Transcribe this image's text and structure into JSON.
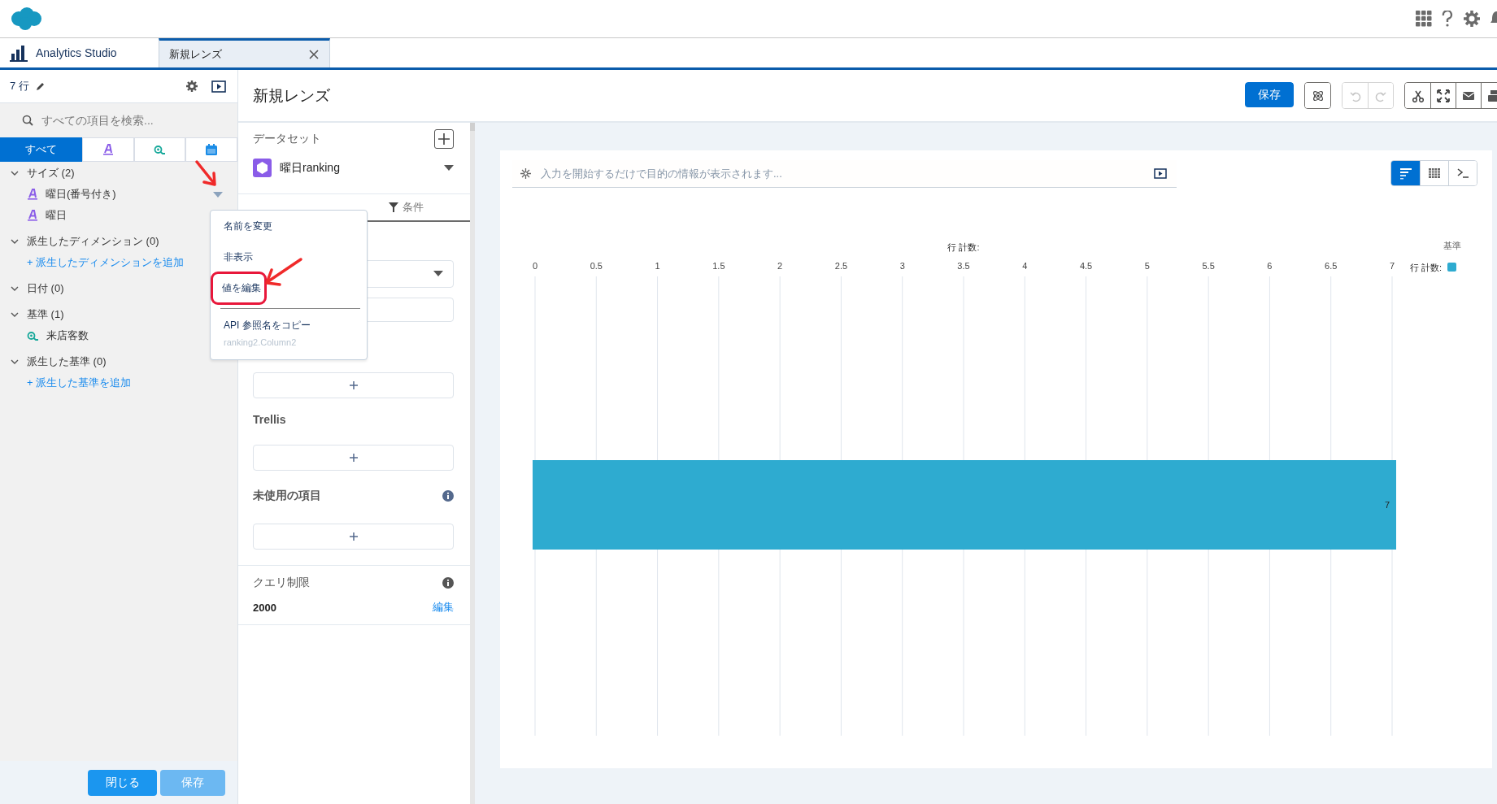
{
  "tabs": [
    {
      "kind": "home",
      "label": "Analytics Studio",
      "selected": false,
      "closable": false
    },
    {
      "kind": "document",
      "label": "新規レンズ",
      "selected": true,
      "closable": true
    }
  ],
  "left_panel": {
    "row_count": "7 行",
    "search": {
      "placeholder": "すべての項目を検索..."
    },
    "filter_tabs": [
      {
        "kind": "all",
        "label": "すべて",
        "selected": true
      },
      {
        "kind": "dimension",
        "selected": false
      },
      {
        "kind": "measure",
        "selected": false
      },
      {
        "kind": "date",
        "selected": false
      }
    ],
    "tree": [
      {
        "kind": "group",
        "label": "サイズ (2)",
        "expanded": true,
        "children": [
          {
            "kind": "dimension",
            "label": "曜日(番号付き)",
            "menu_open": true
          },
          {
            "kind": "dimension",
            "label": "曜日"
          }
        ]
      },
      {
        "kind": "group",
        "label": "派生したディメンション (0)",
        "expanded": true,
        "children": [
          {
            "kind": "add",
            "label": "+ 派生したディメンションを追加"
          }
        ]
      },
      {
        "kind": "group",
        "label": "日付 (0)",
        "expanded": true
      },
      {
        "kind": "group",
        "label": "基準 (1)",
        "expanded": true,
        "children": [
          {
            "kind": "measure",
            "label": "来店客数"
          }
        ]
      },
      {
        "kind": "group",
        "label": "派生した基準 (0)",
        "expanded": true,
        "children": [
          {
            "kind": "add",
            "label": "+ 派生した基準を追加"
          }
        ]
      }
    ],
    "buttons": [
      {
        "label": "閉じる",
        "disabled": false
      },
      {
        "label": "保存",
        "disabled": true
      }
    ]
  },
  "context_menu": {
    "items": [
      {
        "kind": "item",
        "label": "名前を変更",
        "highlighted": false
      },
      {
        "kind": "item",
        "label": "非表示",
        "highlighted": false
      },
      {
        "kind": "item",
        "label": "値を編集",
        "highlighted": true
      },
      {
        "kind": "divider"
      },
      {
        "kind": "copy",
        "label": "API 参照名をコピー",
        "detail": "ranking2.Column2"
      }
    ]
  },
  "annotations": [
    {
      "kind": "arrow"
    },
    {
      "kind": "arrow"
    }
  ],
  "lens": {
    "title": "新規レンズ",
    "toolbar": [
      {
        "kind": "save",
        "label": "保存",
        "disabled": false
      },
      {
        "kind": "explore",
        "disabled": false
      },
      {
        "kind": "undo",
        "disabled": true
      },
      {
        "kind": "redo",
        "disabled": true
      },
      {
        "kind": "cut",
        "disabled": false
      },
      {
        "kind": "fullscreen",
        "disabled": false
      },
      {
        "kind": "email",
        "disabled": false
      },
      {
        "kind": "print",
        "disabled": false
      }
    ]
  },
  "config": {
    "dataset_label": "データセット",
    "dataset": "曜日ranking",
    "conditions_tab": "条件",
    "trellis": "Trellis",
    "unused_fields": "未使用の項目",
    "query_limit": {
      "label": "クエリ制限",
      "value": "2000",
      "edit": "編集"
    }
  },
  "query_bar": {
    "placeholder": "入力を開始するだけで目的の情報が表示されます..."
  },
  "view_modes": [
    {
      "kind": "chart",
      "selected": true
    },
    {
      "kind": "table",
      "selected": false
    },
    {
      "kind": "query",
      "selected": false
    }
  ],
  "chart": {
    "legend_title": "基準",
    "chart_data": {
      "type": "bar",
      "orientation": "horizontal",
      "xlabel": "行 計数:",
      "series": [
        {
          "name": "行 計数:",
          "color": "#2eabd0",
          "values": [
            7
          ]
        }
      ],
      "xlim": [
        0,
        7
      ],
      "grid": true,
      "xticks": [
        0,
        0.5,
        1,
        1.5,
        2,
        2.5,
        3,
        3.5,
        4,
        4.5,
        5,
        5.5,
        6,
        6.5,
        7
      ],
      "data_labels": true
    }
  }
}
